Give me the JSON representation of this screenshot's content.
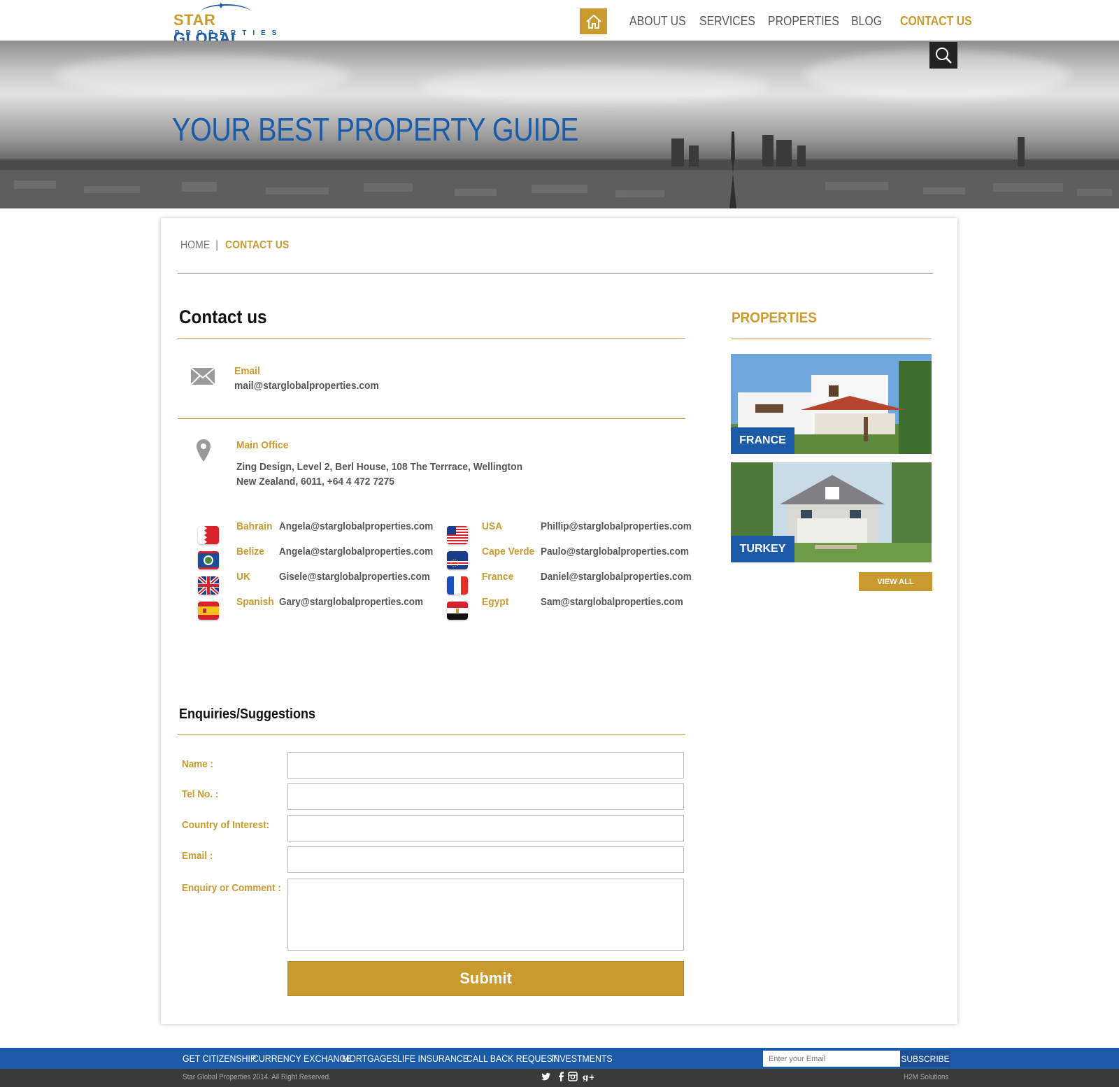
{
  "brand": {
    "logo_top_a": "STAR",
    "logo_top_b": "GLOBAL",
    "logo_bottom": "PROPERTIES",
    "accent": "#c99a2e",
    "primary": "#1b5ba8"
  },
  "nav": {
    "home_icon": "home-icon",
    "items": [
      {
        "label": "ABOUT US",
        "active": false
      },
      {
        "label": "SERVICES",
        "active": false
      },
      {
        "label": "PROPERTIES",
        "active": false
      },
      {
        "label": "BLOG",
        "active": false
      },
      {
        "label": "CONTACT US",
        "active": true
      }
    ]
  },
  "hero": {
    "title": "YOUR BEST PROPERTY GUIDE",
    "search_icon": "search-icon"
  },
  "breadcrumb": {
    "home": "HOME",
    "separator": "|",
    "current": "CONTACT US"
  },
  "contact": {
    "title": "Contact us",
    "email_label": "Email",
    "email_value": "mail@starglobalproperties.com",
    "office_label": "Main Office",
    "office_line1": "Zing Design, Level 2, Berl House,  108 The Terrrace, Wellington",
    "office_line2": "New Zealand, 6011, +64 4 472 7275",
    "countries_left": [
      {
        "name": "Bahrain",
        "email": "Angela@starglobalproperties.com"
      },
      {
        "name": "Belize",
        "email": "Angela@starglobalproperties.com"
      },
      {
        "name": "UK",
        "email": "Gisele@starglobalproperties.com"
      },
      {
        "name": "Spanish",
        "email": "Gary@starglobalproperties.com"
      }
    ],
    "countries_right": [
      {
        "name": "USA",
        "email": "Phillip@starglobalproperties.com"
      },
      {
        "name": "Cape Verde",
        "email": "Paulo@starglobalproperties.com"
      },
      {
        "name": "France",
        "email": "Daniel@starglobalproperties.com"
      },
      {
        "name": "Egypt",
        "email": "Sam@starglobalproperties.com"
      }
    ]
  },
  "form": {
    "title": "Enquiries/Suggestions",
    "name_label": "Name :",
    "tel_label": "Tel No. :",
    "country_label": "Country of Interest:",
    "email_label": "Email :",
    "comment_label": "Enquiry or Comment :",
    "name_value": "",
    "tel_value": "",
    "country_value": "",
    "email_value": "",
    "comment_value": "",
    "submit_label": "Submit"
  },
  "sidebar": {
    "title": "PROPERTIES",
    "cards": [
      {
        "label": "FRANCE"
      },
      {
        "label": "TURKEY"
      }
    ],
    "view_all": "VIEW ALL"
  },
  "footer": {
    "links": [
      "GET CITIZENSHIP",
      "CURRENCY EXCHANGE",
      "MORTGAGES",
      "LIFE INSURANCE",
      "CALL BACK REQUEST",
      "INVESTMENTS"
    ],
    "subscribe_placeholder": "Enter your Email",
    "subscribe_label": "SUBSCRIBE",
    "copyright": "Star Global Properties 2014. All Right Reserved.",
    "credit": "H2M Solutions",
    "social_icons": [
      "twitter-icon",
      "facebook-icon",
      "instagram-icon",
      "google-plus-icon"
    ]
  }
}
